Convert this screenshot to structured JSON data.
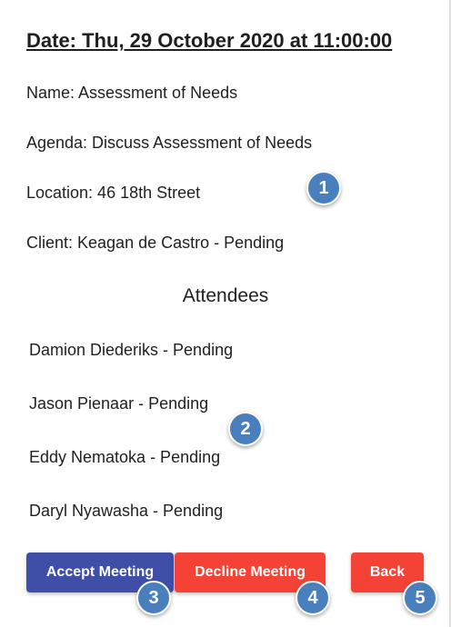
{
  "meeting": {
    "date_line": "Date: Thu, 29 October 2020 at 11:00:00",
    "name": "Name: Assessment of Needs",
    "agenda": "Agenda: Discuss Assessment of Needs",
    "location": "Location: 46 18th Street",
    "client": "Client: Keagan de Castro - Pending"
  },
  "attendees": {
    "heading": "Attendees",
    "items": [
      "Damion Diederiks - Pending",
      "Jason Pienaar - Pending",
      "Eddy Nematoka - Pending",
      "Daryl Nyawasha - Pending"
    ]
  },
  "actions": {
    "accept_label": "Accept Meeting",
    "decline_label": "Decline Meeting",
    "back_label": "Back"
  },
  "badges": [
    "1",
    "2",
    "3",
    "4",
    "5"
  ],
  "colors": {
    "accept": "#3f4fa8",
    "decline": "#f44336",
    "badge": "#4a7fbd"
  }
}
